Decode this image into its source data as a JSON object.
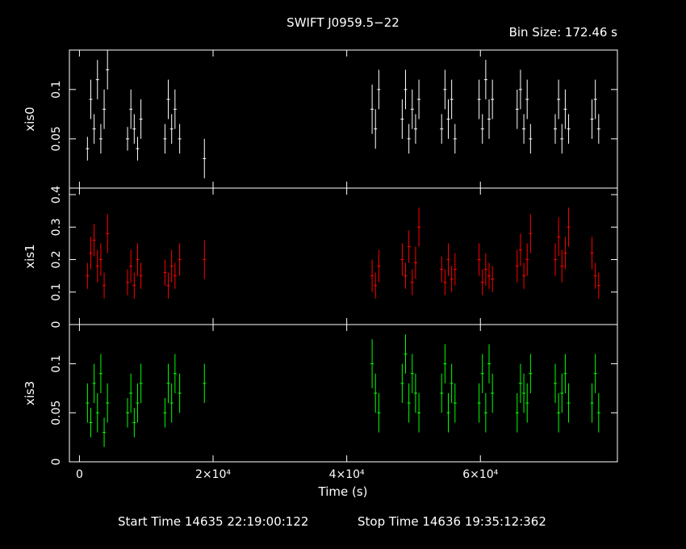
{
  "header": {
    "title": "SWIFT J0959.5−22",
    "bin_size": "Bin Size: 172.46 s"
  },
  "footer": {
    "start_time": "Start Time 14635 22:19:00:122",
    "stop_time": "Stop Time 14636 19:35:12:362"
  },
  "colors": {
    "axes": "#ffffff",
    "xis0": "#ffffff",
    "xis1": "#ff0000",
    "xis3": "#00ff00",
    "background": "#000000"
  },
  "chart_data": {
    "type": "scatter",
    "title": "SWIFT J0959.5−22",
    "xlabel": "Time (s)",
    "xlim": [
      -1500,
      80500
    ],
    "x_ticks": [
      {
        "value": 0,
        "label": "0"
      },
      {
        "value": 20000,
        "label": "2×10⁴"
      },
      {
        "value": 40000,
        "label": "4×10⁴"
      },
      {
        "value": 60000,
        "label": "6×10⁴"
      }
    ],
    "panels": [
      {
        "name": "xis0",
        "ylabel": "xis0",
        "ylim": [
          0,
          0.14
        ],
        "y_ticks": [
          {
            "value": 0.05,
            "label": "0.05"
          },
          {
            "value": 0.1,
            "label": "0.1"
          }
        ],
        "color": "#ffffff",
        "points": [
          [
            1200,
            0.04,
            0.012
          ],
          [
            1700,
            0.09,
            0.02
          ],
          [
            2200,
            0.06,
            0.015
          ],
          [
            2700,
            0.11,
            0.02
          ],
          [
            3200,
            0.05,
            0.015
          ],
          [
            3700,
            0.08,
            0.02
          ],
          [
            4200,
            0.12,
            0.02
          ],
          [
            7200,
            0.05,
            0.012
          ],
          [
            7700,
            0.08,
            0.02
          ],
          [
            8200,
            0.06,
            0.015
          ],
          [
            8700,
            0.04,
            0.012
          ],
          [
            9200,
            0.07,
            0.02
          ],
          [
            12800,
            0.05,
            0.015
          ],
          [
            13300,
            0.09,
            0.02
          ],
          [
            13800,
            0.06,
            0.015
          ],
          [
            14300,
            0.08,
            0.02
          ],
          [
            15000,
            0.05,
            0.015
          ],
          [
            18700,
            0.03,
            0.02
          ],
          [
            43800,
            0.08,
            0.025
          ],
          [
            44300,
            0.06,
            0.02
          ],
          [
            44800,
            0.1,
            0.02
          ],
          [
            48300,
            0.07,
            0.02
          ],
          [
            48800,
            0.1,
            0.02
          ],
          [
            49300,
            0.05,
            0.015
          ],
          [
            49800,
            0.08,
            0.02
          ],
          [
            50300,
            0.06,
            0.015
          ],
          [
            50800,
            0.09,
            0.02
          ],
          [
            54200,
            0.06,
            0.015
          ],
          [
            54700,
            0.1,
            0.02
          ],
          [
            55200,
            0.07,
            0.02
          ],
          [
            55700,
            0.09,
            0.02
          ],
          [
            56200,
            0.05,
            0.015
          ],
          [
            59800,
            0.09,
            0.02
          ],
          [
            60300,
            0.06,
            0.015
          ],
          [
            60800,
            0.11,
            0.02
          ],
          [
            61300,
            0.07,
            0.02
          ],
          [
            61800,
            0.09,
            0.02
          ],
          [
            65500,
            0.08,
            0.02
          ],
          [
            66000,
            0.1,
            0.02
          ],
          [
            66500,
            0.06,
            0.015
          ],
          [
            67000,
            0.09,
            0.02
          ],
          [
            67500,
            0.05,
            0.015
          ],
          [
            71200,
            0.06,
            0.015
          ],
          [
            71700,
            0.09,
            0.02
          ],
          [
            72200,
            0.05,
            0.015
          ],
          [
            72700,
            0.08,
            0.02
          ],
          [
            73200,
            0.06,
            0.015
          ],
          [
            76700,
            0.07,
            0.02
          ],
          [
            77200,
            0.09,
            0.02
          ],
          [
            77700,
            0.06,
            0.015
          ]
        ]
      },
      {
        "name": "xis1",
        "ylabel": "xis1",
        "ylim": [
          0,
          0.42
        ],
        "y_ticks": [
          {
            "value": 0,
            "label": "0"
          },
          {
            "value": 0.1,
            "label": "0.1"
          },
          {
            "value": 0.2,
            "label": "0.2"
          },
          {
            "value": 0.3,
            "label": "0.3"
          },
          {
            "value": 0.4,
            "label": "0.4"
          }
        ],
        "color": "#ff0000",
        "points": [
          [
            1200,
            0.15,
            0.04
          ],
          [
            1700,
            0.22,
            0.05
          ],
          [
            2200,
            0.26,
            0.05
          ],
          [
            2700,
            0.18,
            0.05
          ],
          [
            3200,
            0.2,
            0.05
          ],
          [
            3700,
            0.12,
            0.04
          ],
          [
            4200,
            0.28,
            0.06
          ],
          [
            7200,
            0.13,
            0.04
          ],
          [
            7700,
            0.18,
            0.05
          ],
          [
            8200,
            0.12,
            0.04
          ],
          [
            8700,
            0.2,
            0.05
          ],
          [
            9200,
            0.15,
            0.04
          ],
          [
            12800,
            0.16,
            0.04
          ],
          [
            13300,
            0.12,
            0.04
          ],
          [
            13800,
            0.18,
            0.05
          ],
          [
            14300,
            0.15,
            0.04
          ],
          [
            15000,
            0.2,
            0.05
          ],
          [
            18700,
            0.2,
            0.06
          ],
          [
            43800,
            0.15,
            0.05
          ],
          [
            44300,
            0.12,
            0.04
          ],
          [
            44800,
            0.18,
            0.05
          ],
          [
            48300,
            0.2,
            0.05
          ],
          [
            48800,
            0.15,
            0.04
          ],
          [
            49300,
            0.24,
            0.05
          ],
          [
            49800,
            0.13,
            0.04
          ],
          [
            50300,
            0.19,
            0.05
          ],
          [
            50800,
            0.3,
            0.06
          ],
          [
            54200,
            0.17,
            0.04
          ],
          [
            54700,
            0.13,
            0.04
          ],
          [
            55200,
            0.2,
            0.05
          ],
          [
            55700,
            0.14,
            0.04
          ],
          [
            56200,
            0.17,
            0.05
          ],
          [
            59800,
            0.2,
            0.05
          ],
          [
            60300,
            0.13,
            0.04
          ],
          [
            60800,
            0.17,
            0.05
          ],
          [
            61300,
            0.15,
            0.04
          ],
          [
            61800,
            0.14,
            0.04
          ],
          [
            65500,
            0.18,
            0.05
          ],
          [
            66000,
            0.23,
            0.05
          ],
          [
            66500,
            0.15,
            0.04
          ],
          [
            67000,
            0.2,
            0.05
          ],
          [
            67500,
            0.28,
            0.06
          ],
          [
            71200,
            0.2,
            0.05
          ],
          [
            71700,
            0.27,
            0.06
          ],
          [
            72200,
            0.18,
            0.05
          ],
          [
            72700,
            0.22,
            0.05
          ],
          [
            73200,
            0.3,
            0.06
          ],
          [
            76700,
            0.22,
            0.05
          ],
          [
            77200,
            0.15,
            0.04
          ],
          [
            77700,
            0.12,
            0.04
          ]
        ]
      },
      {
        "name": "xis3",
        "ylabel": "xis3",
        "ylim": [
          0,
          0.14
        ],
        "y_ticks": [
          {
            "value": 0,
            "label": "0"
          },
          {
            "value": 0.05,
            "label": "0.05"
          },
          {
            "value": 0.1,
            "label": "0.1"
          }
        ],
        "color": "#00ff00",
        "points": [
          [
            1200,
            0.06,
            0.02
          ],
          [
            1700,
            0.04,
            0.015
          ],
          [
            2200,
            0.08,
            0.02
          ],
          [
            2700,
            0.05,
            0.02
          ],
          [
            3200,
            0.09,
            0.02
          ],
          [
            3700,
            0.03,
            0.015
          ],
          [
            4200,
            0.06,
            0.02
          ],
          [
            7200,
            0.05,
            0.015
          ],
          [
            7700,
            0.07,
            0.02
          ],
          [
            8200,
            0.04,
            0.015
          ],
          [
            8700,
            0.06,
            0.02
          ],
          [
            9200,
            0.08,
            0.02
          ],
          [
            12800,
            0.05,
            0.015
          ],
          [
            13300,
            0.08,
            0.02
          ],
          [
            13800,
            0.06,
            0.02
          ],
          [
            14300,
            0.09,
            0.02
          ],
          [
            15000,
            0.07,
            0.02
          ],
          [
            18700,
            0.08,
            0.02
          ],
          [
            43800,
            0.1,
            0.025
          ],
          [
            44300,
            0.07,
            0.02
          ],
          [
            44800,
            0.05,
            0.02
          ],
          [
            48300,
            0.08,
            0.02
          ],
          [
            48800,
            0.11,
            0.02
          ],
          [
            49300,
            0.06,
            0.02
          ],
          [
            49800,
            0.09,
            0.02
          ],
          [
            50300,
            0.07,
            0.02
          ],
          [
            50800,
            0.05,
            0.02
          ],
          [
            54200,
            0.07,
            0.02
          ],
          [
            54700,
            0.1,
            0.02
          ],
          [
            55200,
            0.05,
            0.02
          ],
          [
            55700,
            0.08,
            0.02
          ],
          [
            56200,
            0.06,
            0.02
          ],
          [
            59800,
            0.06,
            0.02
          ],
          [
            60300,
            0.09,
            0.02
          ],
          [
            60800,
            0.05,
            0.02
          ],
          [
            61300,
            0.1,
            0.02
          ],
          [
            61800,
            0.07,
            0.02
          ],
          [
            65500,
            0.05,
            0.02
          ],
          [
            66000,
            0.08,
            0.02
          ],
          [
            66500,
            0.07,
            0.02
          ],
          [
            67000,
            0.06,
            0.02
          ],
          [
            67500,
            0.09,
            0.02
          ],
          [
            71200,
            0.08,
            0.02
          ],
          [
            71700,
            0.05,
            0.02
          ],
          [
            72200,
            0.07,
            0.02
          ],
          [
            72700,
            0.09,
            0.02
          ],
          [
            73200,
            0.06,
            0.02
          ],
          [
            76700,
            0.06,
            0.02
          ],
          [
            77200,
            0.09,
            0.02
          ],
          [
            77700,
            0.05,
            0.02
          ]
        ]
      }
    ]
  }
}
